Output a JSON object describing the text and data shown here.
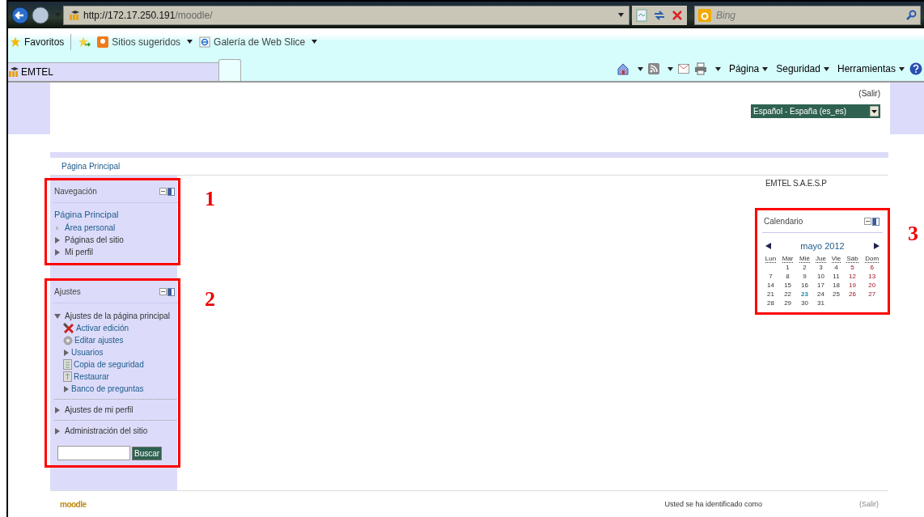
{
  "browser": {
    "url_host": "http://172.17.250.191",
    "url_path": "/moodle/",
    "search_placeholder": "Bing",
    "favorites": [
      {
        "label": "Favoritos",
        "kind": "favorites"
      },
      {
        "label": "Sitios sugeridos",
        "kind": "suggested"
      },
      {
        "label": "Galería de Web Slice",
        "kind": "webslice"
      }
    ],
    "tab": {
      "label": "EMTEL"
    },
    "commands": [
      {
        "label": "Página"
      },
      {
        "label": "Seguridad"
      },
      {
        "label": "Herramientas"
      }
    ]
  },
  "header": {
    "logout": "(Salir)",
    "language": "Español - España (es_es)"
  },
  "breadcrumb": "Página Principal",
  "site_name": "EMTEL S.A.E.S.P",
  "navigation": {
    "title": "Navegación",
    "annotation": "1",
    "items": [
      {
        "label": "Página Principal",
        "kind": "link",
        "children": [
          {
            "label": "Área personal",
            "kind": "leaf"
          },
          {
            "label": "Páginas del sitio",
            "kind": "branch",
            "expanded": false
          },
          {
            "label": "Mi perfil",
            "kind": "branch",
            "expanded": false
          }
        ]
      }
    ]
  },
  "settings": {
    "title": "Ajustes",
    "annotation": "2",
    "search_button": "Buscar",
    "sections": [
      {
        "label": "Ajustes de la página principal",
        "expanded": true,
        "children": [
          {
            "label": "Activar edición",
            "kind": "edit"
          },
          {
            "label": "Editar ajustes",
            "kind": "gear"
          },
          {
            "label": "Usuarios",
            "kind": "branch",
            "expanded": false
          },
          {
            "label": "Copia de seguridad",
            "kind": "backup"
          },
          {
            "label": "Restaurar",
            "kind": "restore"
          },
          {
            "label": "Banco de preguntas",
            "kind": "branch",
            "expanded": false
          }
        ]
      },
      {
        "label": "Ajustes de mi perfil",
        "expanded": false
      },
      {
        "label": "Administración del sitio",
        "expanded": false
      }
    ]
  },
  "calendar": {
    "title": "Calendario",
    "annotation": "3",
    "month": "mayo 2012",
    "weekdays": [
      "Lun",
      "Mar",
      "Mié",
      "Jue",
      "Vie",
      "Sáb",
      "Dom"
    ],
    "weeks": [
      [
        {
          "kind": "empty"
        },
        {
          "day": "1",
          "kind": "weekday"
        },
        {
          "day": "2",
          "kind": "weekday"
        },
        {
          "day": "3",
          "kind": "weekday"
        },
        {
          "day": "4",
          "kind": "weekday"
        },
        {
          "day": "5",
          "kind": "weekend"
        },
        {
          "day": "6",
          "kind": "weekend"
        }
      ],
      [
        {
          "day": "7",
          "kind": "weekday"
        },
        {
          "day": "8",
          "kind": "weekday"
        },
        {
          "day": "9",
          "kind": "weekday"
        },
        {
          "day": "10",
          "kind": "weekday"
        },
        {
          "day": "11",
          "kind": "weekday"
        },
        {
          "day": "12",
          "kind": "weekend"
        },
        {
          "day": "13",
          "kind": "weekend"
        }
      ],
      [
        {
          "day": "14",
          "kind": "weekday"
        },
        {
          "day": "15",
          "kind": "weekday"
        },
        {
          "day": "16",
          "kind": "weekday"
        },
        {
          "day": "17",
          "kind": "weekday"
        },
        {
          "day": "18",
          "kind": "weekday"
        },
        {
          "day": "19",
          "kind": "weekend"
        },
        {
          "day": "20",
          "kind": "weekend"
        }
      ],
      [
        {
          "day": "21",
          "kind": "weekday"
        },
        {
          "day": "22",
          "kind": "weekday"
        },
        {
          "day": "23",
          "kind": "today"
        },
        {
          "day": "24",
          "kind": "weekday"
        },
        {
          "day": "25",
          "kind": "weekday"
        },
        {
          "day": "26",
          "kind": "weekend"
        },
        {
          "day": "27",
          "kind": "weekend"
        }
      ],
      [
        {
          "day": "28",
          "kind": "weekday"
        },
        {
          "day": "29",
          "kind": "weekday"
        },
        {
          "day": "30",
          "kind": "weekday"
        },
        {
          "day": "31",
          "kind": "weekday"
        }
      ]
    ]
  },
  "footer": {
    "logo": "moodle",
    "login_info": "Usted se ha identificado como",
    "logout": "(Salir)"
  }
}
